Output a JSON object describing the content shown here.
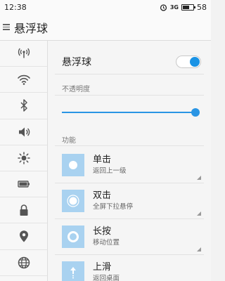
{
  "status_bar": {
    "time": "12:38",
    "battery_level": "58",
    "icons": [
      "alarm-icon",
      "signal-icon",
      "battery-icon"
    ],
    "signal_label": "3G"
  },
  "app_bar": {
    "title": "悬浮球"
  },
  "sidebar": {
    "items": [
      "hotspot-icon",
      "wifi-icon",
      "bluetooth-icon",
      "volume-icon",
      "brightness-icon",
      "battery-icon",
      "lock-icon",
      "location-icon",
      "globe-icon"
    ]
  },
  "main": {
    "float_ball_label": "悬浮球",
    "float_ball_enabled": true,
    "opacity_label": "不透明度",
    "opacity_value": 1.0,
    "function_label": "功能",
    "gestures": [
      {
        "title": "单击",
        "subtitle": "返回上一级",
        "icon": "single-tap-icon"
      },
      {
        "title": "双击",
        "subtitle": "全屏下拉悬停",
        "icon": "double-tap-icon"
      },
      {
        "title": "长按",
        "subtitle": "移动位置",
        "icon": "long-press-icon"
      },
      {
        "title": "上滑",
        "subtitle": "返回桌面",
        "icon": "swipe-up-icon"
      }
    ]
  },
  "colors": {
    "accent": "#2a95e4",
    "thumb_bg": "#a9d2f0"
  }
}
